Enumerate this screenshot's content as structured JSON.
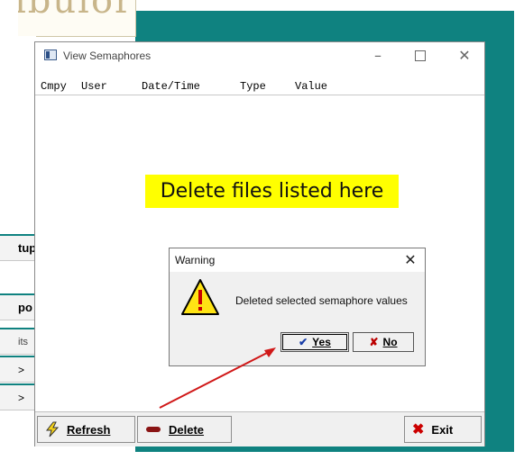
{
  "background": {
    "logo_text": "ibulor",
    "left_items": [
      "tup",
      "po",
      "its",
      ">",
      ">"
    ],
    "accent_color": "#0f8280"
  },
  "window": {
    "title": "View Semaphores",
    "columns": [
      "Cmpy",
      "User",
      "Date/Time",
      "Type",
      "Value"
    ]
  },
  "annotation": {
    "callout_text": "Delete files listed here",
    "callout_color": "#ffff00",
    "arrow_color": "#d01818"
  },
  "dialog": {
    "title": "Warning",
    "message": "Deleted selected semaphore values",
    "yes_label": "Yes",
    "no_label": "No",
    "icon": "warning-triangle-icon"
  },
  "toolbar": {
    "refresh_label": "Refresh",
    "delete_label": "Delete",
    "exit_label": "Exit"
  }
}
